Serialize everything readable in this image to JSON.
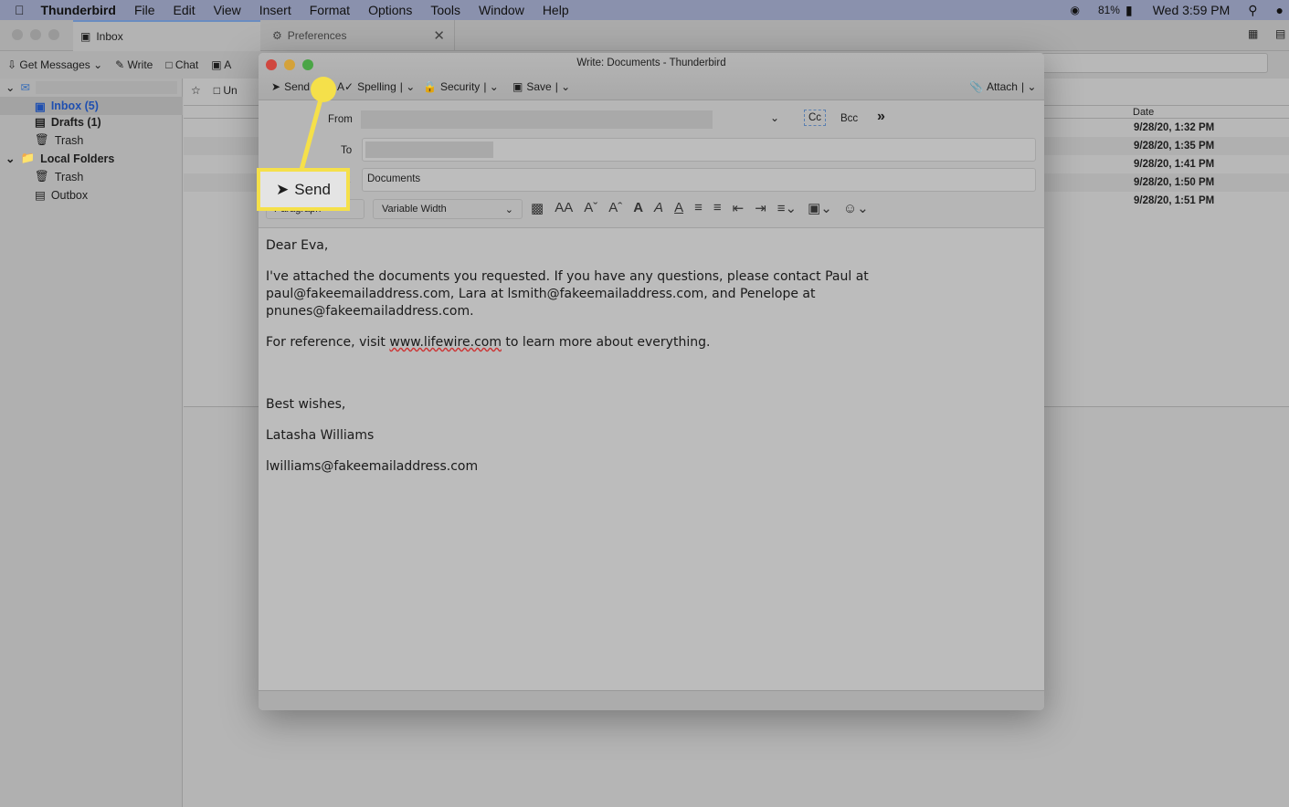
{
  "menubar": {
    "app": "Thunderbird",
    "items": [
      "File",
      "Edit",
      "View",
      "Insert",
      "Format",
      "Options",
      "Tools",
      "Window",
      "Help"
    ],
    "battery": "81%",
    "clock": "Wed 3:59 PM"
  },
  "tabs": [
    {
      "label": "Inbox"
    },
    {
      "label": "Preferences"
    }
  ],
  "toolbar": {
    "get_messages": "Get Messages",
    "write": "Write",
    "chat": "Chat",
    "address": "A"
  },
  "folders": [
    {
      "label": "Inbox (5)"
    },
    {
      "label": "Drafts (1)"
    },
    {
      "label": "Trash"
    },
    {
      "label": "Local Folders"
    },
    {
      "label": "Trash"
    },
    {
      "label": "Outbox"
    }
  ],
  "list": {
    "filter_label": "Un",
    "date_header": "Date",
    "dates": [
      "9/28/20, 1:32 PM",
      "9/28/20, 1:35 PM",
      "9/28/20, 1:41 PM",
      "9/28/20, 1:50 PM",
      "9/28/20, 1:51 PM"
    ]
  },
  "compose": {
    "title": "Write: Documents - Thunderbird",
    "send": "Send",
    "spelling": "Spelling",
    "security": "Security",
    "save": "Save",
    "attach": "Attach",
    "from_label": "From",
    "to_label": "To",
    "subject_label": "t",
    "subject": "Documents",
    "cc": "Cc",
    "bcc": "Bcc",
    "paragraph": "Paragraph",
    "font": "Variable Width",
    "body": {
      "greeting": "Dear Eva,",
      "p1": "I've attached the documents you requested. If you have any questions, please contact Paul at paul@fakeemailaddress.com, Lara at lsmith@fakeemailaddress.com, and Penelope at pnunes@fakeemailaddress.com.",
      "p2_pre": "For reference, visit ",
      "p2_link": "www.lifewire.com",
      "p2_post": " to learn more about everything.",
      "closing": "Best wishes,",
      "name": "Latasha Williams",
      "email": "lwilliams@fakeemailaddress.com"
    }
  },
  "callout": {
    "label": "Send",
    "color": "#f5e04a"
  }
}
